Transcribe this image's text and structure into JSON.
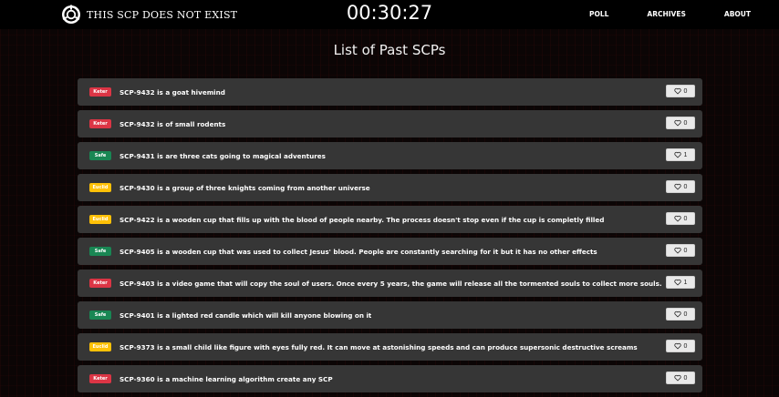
{
  "navbar": {
    "brand": "THIS SCP DOES NOT EXIST",
    "timer": "00:30:27",
    "links": [
      "POLL",
      "ARCHIVES",
      "ABOUT"
    ]
  },
  "page": {
    "title": "List of Past SCPs"
  },
  "scps": [
    {
      "class": "Keter",
      "text": "SCP-9432 is a goat hivemind",
      "likes": "0"
    },
    {
      "class": "Keter",
      "text": "SCP-9432 is of small rodents",
      "likes": "0"
    },
    {
      "class": "Safe",
      "text": "SCP-9431 is are three cats going to magical adventures",
      "likes": "1"
    },
    {
      "class": "Euclid",
      "text": "SCP-9430 is a group of three knights coming from another universe",
      "likes": "0"
    },
    {
      "class": "Euclid",
      "text": "SCP-9422 is a wooden cup that fills up with the blood of people nearby. The process doesn't stop even if the cup is completly filled",
      "likes": "0"
    },
    {
      "class": "Safe",
      "text": "SCP-9405 is a wooden cup that was used to collect Jesus' blood. People are constantly searching for it but it has no other effects",
      "likes": "0"
    },
    {
      "class": "Keter",
      "text": "SCP-9403 is a video game that will copy the soul of users. Once every 5 years, the game will release all the tormented souls to collect more souls.",
      "likes": "1"
    },
    {
      "class": "Safe",
      "text": "SCP-9401 is a lighted red candle which will kill anyone blowing on it",
      "likes": "0"
    },
    {
      "class": "Euclid",
      "text": "SCP-9373 is a small child like figure with eyes fully red. It can move at astonishing speeds and can produce supersonic destructive screams",
      "likes": "0"
    },
    {
      "class": "Keter",
      "text": "SCP-9360 is a machine learning algorithm create any SCP",
      "likes": "0"
    }
  ],
  "colors": {
    "keter": "#dc3545",
    "safe": "#198754",
    "euclid": "#ffc107",
    "row_bg": "#363636",
    "navbar_bg": "#000000"
  },
  "icons": {
    "logo": "scp-foundation-logo-icon",
    "like": "heart-icon"
  }
}
